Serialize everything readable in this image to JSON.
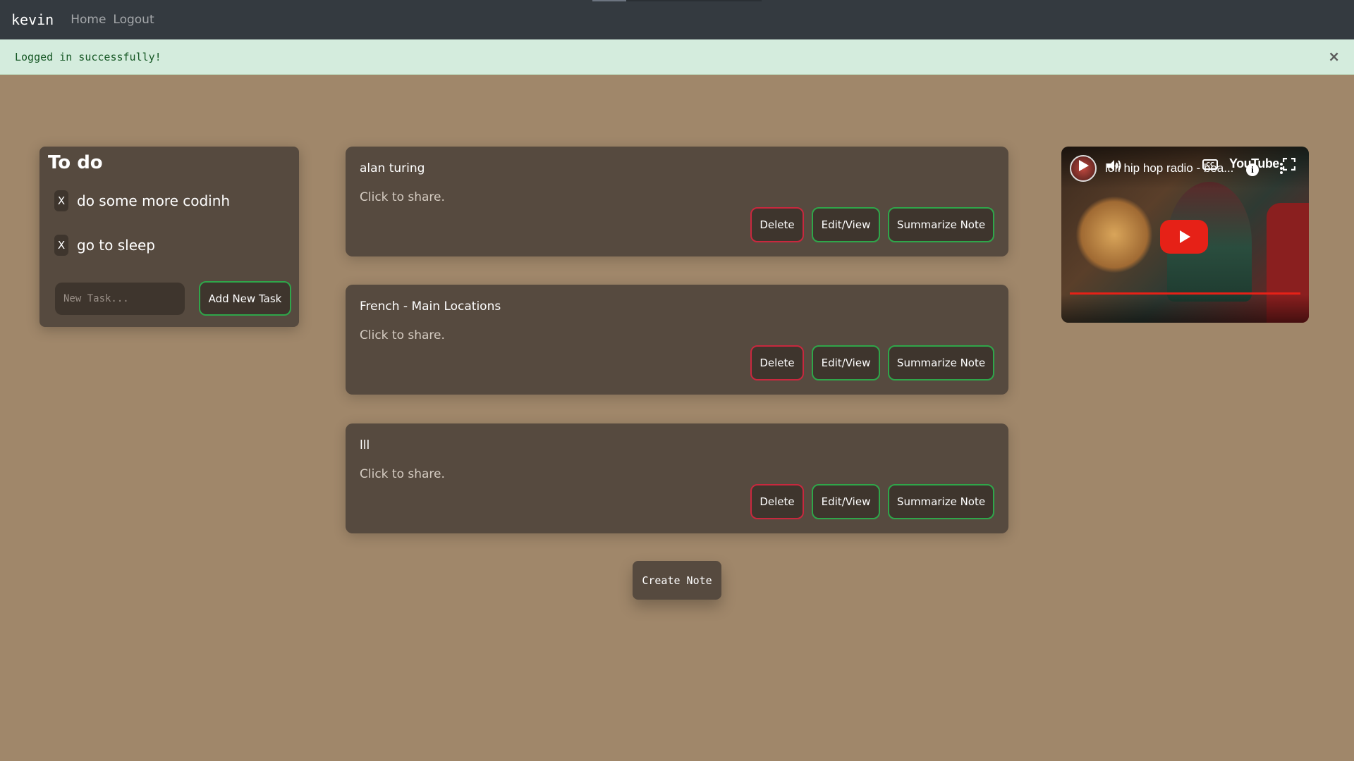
{
  "navbar": {
    "brand": "kevin",
    "links": [
      "Home",
      "Logout"
    ]
  },
  "alert": {
    "message": "Logged in successfully!",
    "close_symbol": "×"
  },
  "todo": {
    "title": "To do",
    "items": [
      {
        "remove_label": "X",
        "text": "do some more codinh"
      },
      {
        "remove_label": "X",
        "text": "go to sleep"
      }
    ],
    "input_placeholder": "New Task...",
    "add_button": "Add New Task"
  },
  "notes": [
    {
      "title": "alan turing",
      "share": "Click to share.",
      "delete": "Delete",
      "edit": "Edit/View",
      "summarize": "Summarize Note"
    },
    {
      "title": "French - Main Locations",
      "share": "Click to share.",
      "delete": "Delete",
      "edit": "Edit/View",
      "summarize": "Summarize Note"
    },
    {
      "title": "lll",
      "share": "Click to share.",
      "delete": "Delete",
      "edit": "Edit/View",
      "summarize": "Summarize Note"
    }
  ],
  "create_note_button": "Create Note",
  "video": {
    "title": "lofi hip hop radio - bea...",
    "logo_text": "YouTube",
    "cc_label": "CC",
    "info_symbol": "i",
    "progress": 1.0,
    "icons": [
      "play-icon",
      "volume-icon",
      "closed-captions-icon",
      "youtube-logo",
      "fullscreen-icon",
      "info-icon",
      "more-options-icon"
    ]
  },
  "colors": {
    "background": "#a0876a",
    "card": "#564a3f",
    "navbar": "#343a40",
    "alert_bg": "#d4ecdd",
    "button_green": "#2fa64a",
    "button_red": "#c8283e",
    "youtube_red": "#e62117"
  }
}
